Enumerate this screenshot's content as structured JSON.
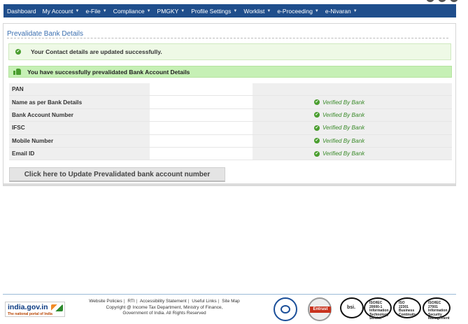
{
  "nav": {
    "items": [
      {
        "label": "Dashboard",
        "dropdown": false
      },
      {
        "label": "My Account",
        "dropdown": true
      },
      {
        "label": "e-File",
        "dropdown": true
      },
      {
        "label": "Compliance",
        "dropdown": true
      },
      {
        "label": "PMGKY",
        "dropdown": true
      },
      {
        "label": "Profile Settings",
        "dropdown": true
      },
      {
        "label": "Worklist",
        "dropdown": true
      },
      {
        "label": "e-Proceeding",
        "dropdown": true
      },
      {
        "label": "e-Nivaran",
        "dropdown": true
      }
    ],
    "background": "#1f4e8c"
  },
  "panel": {
    "title": "Prevalidate Bank Details",
    "contact_message": "Your Contact details are updated successfully.",
    "success_message": "You have successfully prevalidated Bank Account Details",
    "rows": [
      {
        "label": "PAN",
        "status": ""
      },
      {
        "label": "Name as per Bank Details",
        "status": "Verified By Bank"
      },
      {
        "label": "Bank Account Number",
        "status": "Verified By Bank"
      },
      {
        "label": "IFSC",
        "status": "Verified By Bank"
      },
      {
        "label": "Mobile Number",
        "status": "Verified By Bank"
      },
      {
        "label": "Email ID",
        "status": "Verified By Bank"
      }
    ],
    "update_button": "Click here to Update Prevalidated bank account number"
  },
  "footer": {
    "logo_main": "india.gov.in",
    "logo_sub": "The national portal of India",
    "links": [
      "Website Policies",
      "RTI",
      "Accessibility Statement",
      "Useful Links",
      "Site Map"
    ],
    "copyright_line1": "Copyright @ Income Tax Department, Ministry of Finance,",
    "copyright_line2": "Government of India. All Rights Reserved",
    "entrust_label": "Entrust",
    "bsi_label": "bsi.",
    "certs": [
      {
        "l1": "ISO/IEC",
        "l2": "20000-1",
        "l3": "Information Technology Service"
      },
      {
        "l1": "ISO",
        "l2": "22301",
        "l3": "Business Continuity"
      },
      {
        "l1": "ISO/IEC",
        "l2": "27001",
        "l3": "Information Security Management"
      }
    ]
  },
  "colors": {
    "accent": "#1f4e8c",
    "success": "#4a9e2f",
    "success_bg": "#c6f0b5"
  }
}
